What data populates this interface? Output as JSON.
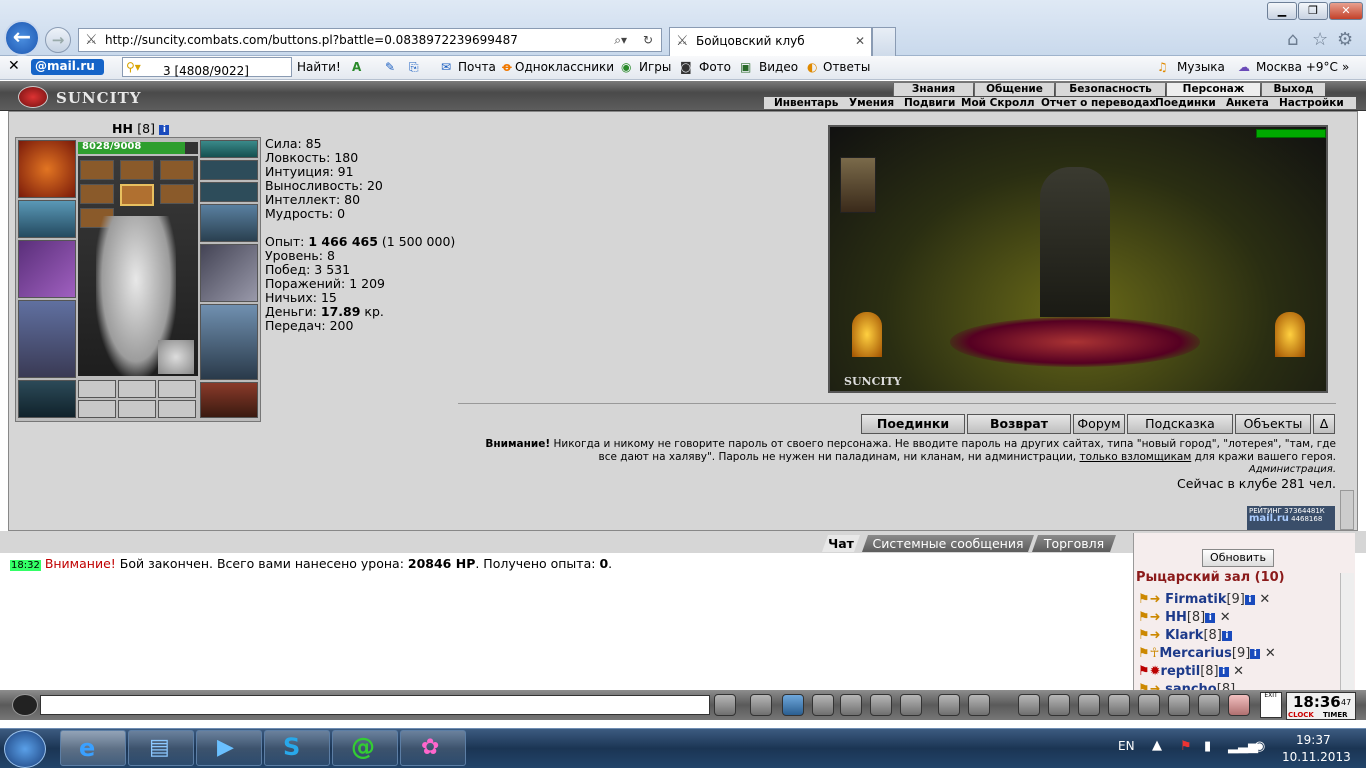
{
  "browser": {
    "url": "http://suncity.combats.com/buttons.pl?battle=0.0838972239699487",
    "tab_title": "Бойцовский клуб",
    "mailru_label": "@mail.ru",
    "search_box": "3 [4808/9022]",
    "search_button": "Найти!",
    "bookmarks": [
      "Почта",
      "Одноклассники",
      "Игры",
      "Фото",
      "Видео",
      "Ответы",
      "Музыка",
      "Москва +9°C"
    ]
  },
  "game": {
    "logo": "SUNCITY",
    "menu_top": [
      "Знания",
      "Общение",
      "Безопасность",
      "Персонаж",
      "Выход"
    ],
    "menu_bottom": [
      "Инвентарь",
      "Умения",
      "Подвиги",
      "Мой Скролл",
      "Отчет о переводах",
      "Поединки",
      "Анкета",
      "Настройки"
    ],
    "character": {
      "name": "НН",
      "level": "[8]",
      "hp": "8028/9008",
      "hp_fraction": 0.89
    },
    "stats": {
      "strength": "Сила: 85",
      "agility": "Ловкость: 180",
      "intuition": "Интуиция: 91",
      "stamina": "Выносливость: 20",
      "intellect": "Интеллект: 80",
      "wisdom": "Мудрость: 0"
    },
    "progress": {
      "exp_label": "Опыт: ",
      "exp_value": "1 466 465",
      "exp_next": " (1 500 000)",
      "level": "Уровень: 8",
      "wins": "Побед: 3 531",
      "losses": "Поражений: 1 209",
      "draws": "Ничьих: 15",
      "money_label": "Деньги: ",
      "money_value": "17.89",
      "money_unit": " кр.",
      "transfers": "Передач: 200"
    },
    "room_caption": "SUNCITY",
    "buttons": [
      "Поединки",
      "Возврат",
      "Форум",
      "Подсказка",
      "Объекты",
      "Δ"
    ],
    "warning_bold": "Внимание!",
    "warning_text1": " Никогда и никому не говорите пароль от своего персонажа. Не вводите пароль на других сайтах, типа \"новый город\", \"лотерея\", \"там, где",
    "warning_text2": "все дают на халяву\". Пароль не нужен ни паладинам, ни кланам, ни администрации, ",
    "warning_link": "только взломщикам",
    "warning_text3": " для кражи вашего героя.",
    "admin_sign": "Администрация.",
    "online": "Сейчас в клубе 281 чел.",
    "rating_label": "РЕЙТИНГ",
    "rating_num1": "37364481К",
    "rating_num2": "4468168",
    "rating_brand": "mail.ru"
  },
  "chat": {
    "tabs": [
      "Чат",
      "Системные сообщения",
      "Торговля"
    ],
    "time": "18:32",
    "msg_attention": "Внимание!",
    "msg_part1": " Бой закончен. Всего вами нанесено урона: ",
    "damage": "20846 HP",
    "msg_part2": ". Получено опыта: ",
    "exp_gain": "0",
    "msg_part3": "."
  },
  "room": {
    "refresh": "Обновить",
    "title": "Рыцарский зал (10)",
    "players": [
      {
        "name": "Firmatik",
        "level": "[9]"
      },
      {
        "name": "НН",
        "level": "[8]"
      },
      {
        "name": "Klark",
        "level": "[8]"
      },
      {
        "name": "Mercarius",
        "level": "[9]"
      },
      {
        "name": "reptil",
        "level": "[8]"
      },
      {
        "name": "sancho",
        "level": "[8]"
      }
    ]
  },
  "clock": {
    "time": "18:36",
    "seconds": "47",
    "clock_label": "CLOCK",
    "timer_label": "TIMER",
    "exit_label": "EXIT"
  },
  "taskbar": {
    "lang": "EN",
    "time": "19:37",
    "date": "10.11.2013"
  },
  "colors": {
    "hp_green": "#2e9e2e",
    "player_blue": "#1d3a8a",
    "room_title": "#8b1a1a",
    "alert_red": "#c00000",
    "time_green": "#33ff66"
  }
}
